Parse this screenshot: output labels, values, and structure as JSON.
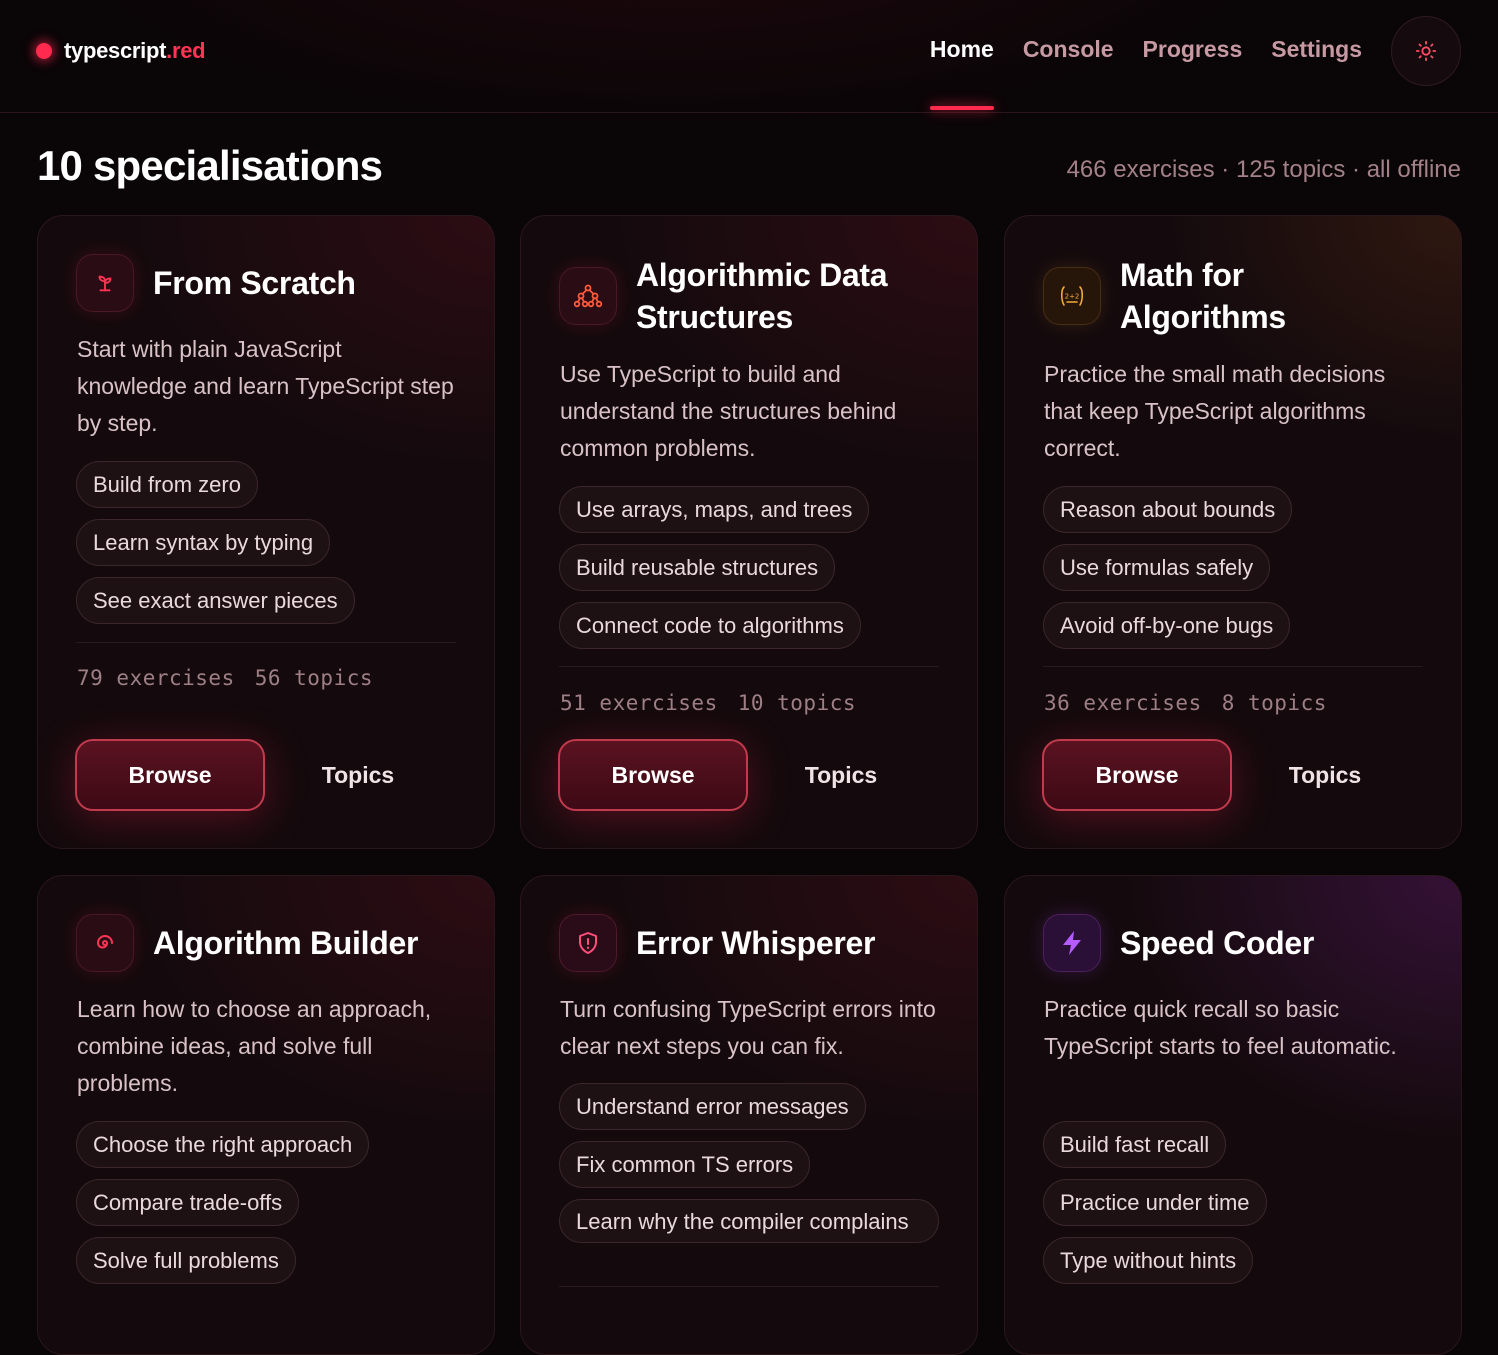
{
  "brand": {
    "name": "typescript",
    "tld": ".red"
  },
  "nav": [
    {
      "label": "Home",
      "active": true
    },
    {
      "label": "Console",
      "active": false
    },
    {
      "label": "Progress",
      "active": false
    },
    {
      "label": "Settings",
      "active": false
    }
  ],
  "theme_toggle": {
    "icon": "sun-icon"
  },
  "heading": {
    "title": "10 specialisations",
    "meta": "466 exercises · 125 topics · all offline"
  },
  "cards": [
    {
      "title": "From Scratch",
      "icon": "sprout-icon",
      "accent": "#ff3454",
      "description": "Start with plain JavaScript knowledge and learn TypeScript step by step.",
      "chips": [
        "Build from zero",
        "Learn syntax by typing",
        "See exact answer pieces"
      ],
      "exercises": "79 exercises",
      "topics": "56 topics",
      "browse_label": "Browse",
      "topics_label": "Topics"
    },
    {
      "title": "Algorithmic Data Structures",
      "icon": "tree-graph-icon",
      "accent": "#ff5a3c",
      "description": "Use TypeScript to build and understand the structures behind common problems.",
      "chips": [
        "Use arrays, maps, and trees",
        "Build reusable structures",
        "Connect code to algorithms"
      ],
      "exercises": "51 exercises",
      "topics": "10 topics",
      "browse_label": "Browse",
      "topics_label": "Topics"
    },
    {
      "title": "Math for Algorithms",
      "icon": "formula-icon",
      "accent": "#f0a83c",
      "description": "Practice the small math decisions that keep TypeScript algorithms correct.",
      "chips": [
        "Reason about bounds",
        "Use formulas safely",
        "Avoid off-by-one bugs"
      ],
      "exercises": "36 exercises",
      "topics": "8 topics",
      "browse_label": "Browse",
      "topics_label": "Topics"
    },
    {
      "title": "Algorithm Builder",
      "icon": "spiral-icon",
      "accent": "#ff3454",
      "description": "Learn how to choose an approach, combine ideas, and solve full problems.",
      "chips": [
        "Choose the right approach",
        "Compare trade-offs",
        "Solve full problems"
      ]
    },
    {
      "title": "Error Whisperer",
      "icon": "shield-alert-icon",
      "accent": "#ff4d7a",
      "description": "Turn confusing TypeScript errors into clear next steps you can fix.",
      "chips": [
        "Understand error messages",
        "Fix common TS errors",
        "Learn why the compiler complains"
      ]
    },
    {
      "title": "Speed Coder",
      "icon": "lightning-icon",
      "accent": "#b45cff",
      "description": "Practice quick recall so basic TypeScript starts to feel automatic.",
      "chips": [
        "Build fast recall",
        "Practice under time",
        "Type without hints"
      ]
    }
  ]
}
